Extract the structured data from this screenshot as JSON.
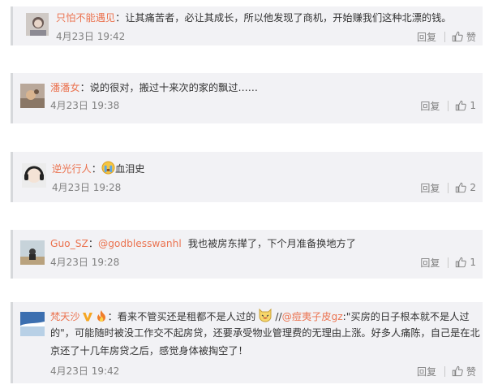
{
  "comments": [
    {
      "username": "只怕不能遇见",
      "separator": "：",
      "text": "让其痛苦者，必让其成长，所以他发现了商机，开始赚我们这种北漂的钱。",
      "time": "4月23日 19:42",
      "reply_label": "回复",
      "like_label": "赞"
    },
    {
      "username": "潘潘女",
      "separator": "：",
      "text": "说的很对，搬过十来次的家的飘过……",
      "time": "4月23日 19:38",
      "reply_label": "回复",
      "like_count": "1"
    },
    {
      "username": "逆光行人",
      "separator": "：",
      "text": "血泪史",
      "time": "4月23日 19:28",
      "reply_label": "回复",
      "like_count": "2"
    },
    {
      "username": "Guo_SZ",
      "separator": "：",
      "mention": "@godblesswanhl",
      "text": "我也被房东撵了，下个月准备换地方了",
      "time": "4月23日 19:28",
      "reply_label": "回复",
      "like_count": "1"
    },
    {
      "username": "梵天沙",
      "separator": "：",
      "text_a": "看来不管买还是租都不是人过的",
      "repost_marker": "//",
      "mention": "@痘夷子皮gz",
      "text_b": ":\"买房的日子根本就不是人过",
      "line2": "的\"，可能随时被没工作交不起房贷，还要承受物业管理费的无理由上涨。好多人痛陈，自己是在北",
      "line3": "京还了十几年房贷之后，感觉身体被掏空了！",
      "time": "4月23日 19:42",
      "reply_label": "回复",
      "like_label": "赞"
    }
  ],
  "colors": {
    "username": "#eb7350",
    "card_bg": "#f2f2f5",
    "meta": "#808080"
  },
  "icons": [
    "thumbs-up-icon",
    "crying-face-emoji",
    "grinning-cat-emoji",
    "verified-v-badge",
    "fire-emoji"
  ]
}
